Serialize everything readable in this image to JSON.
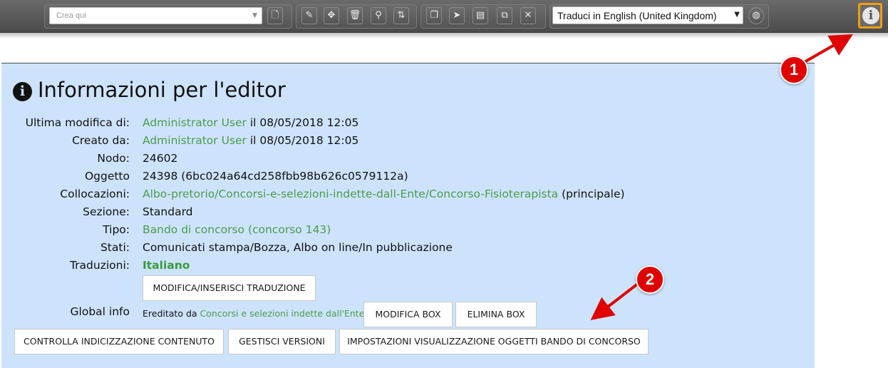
{
  "toolbar": {
    "create_placeholder": "Crea qui",
    "language_select_value": "Traduci in English (United Kingdom)"
  },
  "callouts": [
    "1",
    "2"
  ],
  "panel": {
    "title": "Informazioni per l'editor",
    "rows": [
      {
        "label": "Ultima modifica di:",
        "link": "Administrator User",
        "text": " il 08/05/2018 12:05"
      },
      {
        "label": "Creato da:",
        "link": "Administrator User",
        "text": " il 08/05/2018 12:05"
      },
      {
        "label": "Nodo:",
        "text": "24602"
      },
      {
        "label": "Oggetto",
        "text": "24398 (6bc024a64cd258fbb98b626c0579112a)"
      },
      {
        "label": "Collocazioni:",
        "link": "Albo-pretorio/Concorsi-e-selezioni-indette-dall-Ente/Concorso-Fisioterapista",
        "text": " (principale)"
      },
      {
        "label": "Sezione:",
        "text": "Standard"
      },
      {
        "label": "Tipo:",
        "link": "Bando di concorso (concorso 143)"
      },
      {
        "label": "Stati:",
        "text": "Comunicati stampa/Bozza, Albo on line/In pubblicazione"
      },
      {
        "label": "Traduzioni:",
        "link": "Italiano"
      }
    ],
    "translation_button": "MODIFICA/INSERISCI TRADUZIONE",
    "global_info": {
      "label": "Global info",
      "inherited_prefix": "Ereditato da",
      "inherited_link": "Concorsi e selezioni indette dall'Ente",
      "edit_box": "MODIFICA BOX",
      "delete_box": "ELIMINA BOX"
    },
    "bottom_buttons": {
      "check_indexing": "CONTROLLA INDICIZZAZIONE CONTENUTO",
      "manage_versions": "GESTISCI VERSIONI",
      "display_settings": "IMPOSTAZIONI VISUALIZZAZIONE OGGETTI BANDO DI CONCORSO"
    }
  },
  "colors": {
    "panel_background": "#cde3fb",
    "link_green": "#4d9b4d",
    "callout_red": "#e00000",
    "info_button_highlight": "#f39c12"
  }
}
